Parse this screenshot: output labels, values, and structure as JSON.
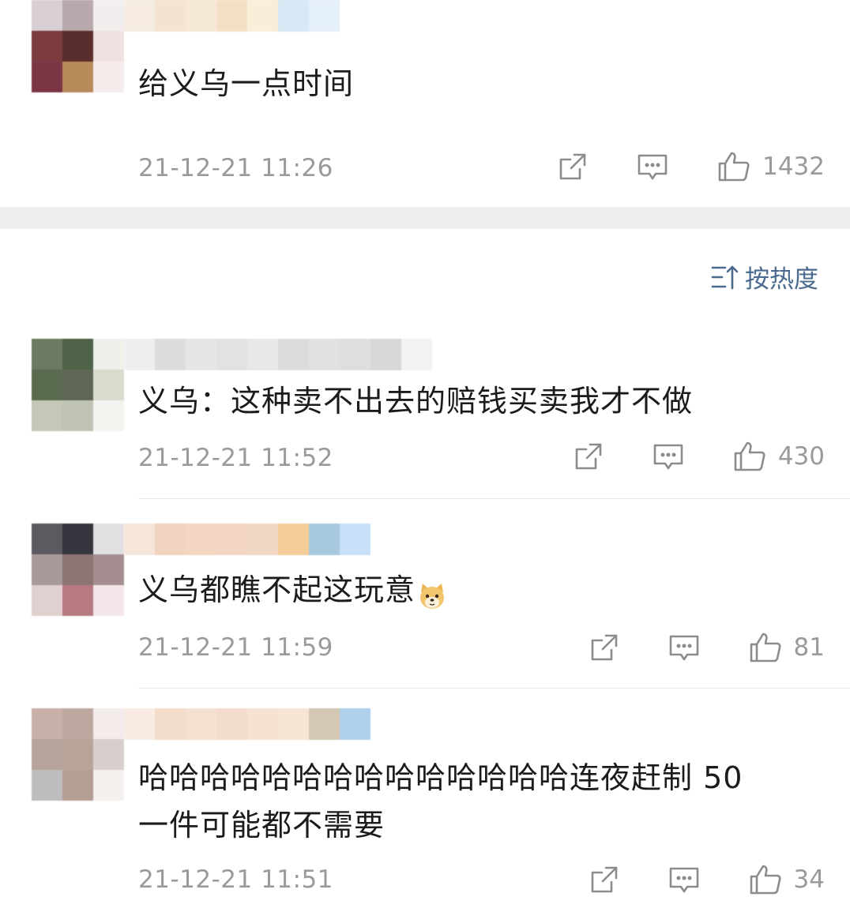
{
  "sort": {
    "label": "按热度",
    "icon": "sort-icon"
  },
  "comments": [
    {
      "text": "给义乌一点时间",
      "time": "21-12-21 11:26",
      "likes": "1432"
    },
    {
      "text": "义乌：这种卖不出去的赔钱买卖我才不做",
      "time": "21-12-21 11:52",
      "likes": "430"
    },
    {
      "text": "义乌都瞧不起这玩意",
      "emoji": "doge-emoji",
      "time": "21-12-21 11:59",
      "likes": "81"
    },
    {
      "text_line1": "哈哈哈哈哈哈哈哈哈哈哈哈哈哈连夜赶制 50",
      "text_line2": "一件可能都不需要",
      "time": "21-12-21 11:51",
      "likes": "34"
    }
  ],
  "icons": {
    "share": "share-icon",
    "reply": "comment-icon",
    "like": "thumbs-up-icon"
  },
  "colors": {
    "sort_accent": "#4a6a8e",
    "timestamp": "#9a9a9a",
    "divider": "#eeeeee"
  }
}
